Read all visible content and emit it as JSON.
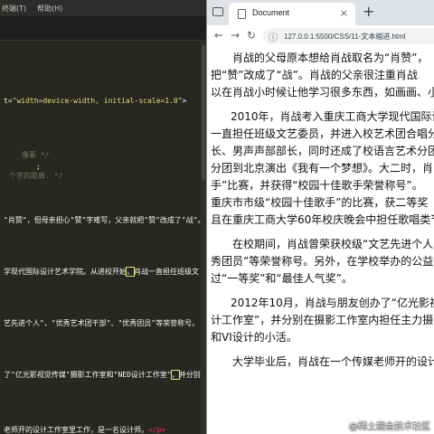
{
  "editor": {
    "menu": [
      "终端(T)",
      "帮助(H)"
    ],
    "code": [
      {
        "parts": [
          {
            "t": "t=",
            "c": "white"
          },
          {
            "t": "\"width=device-width, initial-scale=1.0\"",
            "c": "yellow"
          },
          {
            "t": ">",
            "c": "white"
          }
        ]
      },
      {
        "parts": [
          {
            "t": "像素 */",
            "c": "gray"
          }
        ]
      },
      {
        "parts": [
          {
            "t": ";",
            "c": "white"
          }
        ]
      },
      {
        "parts": [
          {
            "t": "个字的距离. */",
            "c": "gray"
          }
        ]
      },
      {
        "parts": [
          {
            "t": "\"肖赞\"，但母亲担心\"赞\"字难写，父亲就把\"赞\"改成了\"战\"。",
            "c": "white"
          }
        ]
      },
      {
        "parts": [
          {
            "t": "学现代国际设计艺术学院。从进校开始",
            "c": "white"
          },
          {
            "t": "，",
            "c": "hl"
          },
          {
            "t": "肖战一直担任班级文",
            "c": "white"
          }
        ]
      },
      {
        "parts": [
          {
            "t": "艺先进个人\"、\"优秀艺术团干部\"、\"优秀团员\"等荣誉称号。",
            "c": "white"
          }
        ]
      },
      {
        "parts": [
          {
            "t": "了\"亿光影视觉传媒\"摄影工作室和\"NED设计工作室\"",
            "c": "white"
          },
          {
            "t": "，",
            "c": "hl"
          },
          {
            "t": "并分别在",
            "c": "white"
          }
        ]
      },
      {
        "parts": [
          {
            "t": "老师开的设计工作室里工作，是一名设计师。",
            "c": "white"
          },
          {
            "t": "</p>",
            "c": "pink"
          }
        ]
      }
    ]
  },
  "browser": {
    "tab_title": "Document",
    "tab_close": "×",
    "new_tab": "+",
    "nav_back": "←",
    "nav_forward": "→",
    "nav_reload": "↻",
    "info_icon": "ⓘ",
    "url": "127.0.0.1:5500/CSS/11-文本缩进.html"
  },
  "content_lines": [
    "肖战的父母原本想给肖战取名为“肖赞”，",
    "把“赞”改成了“战”。肖战的父亲很注重肖战",
    "以在肖战小时候让他学习很多东西，如画画、小",
    "2010年，肖战考入重庆工商大学现代国际设",
    "一直担任班级文艺委员，并进入校艺术团合唱分",
    "长、男声声部部长，同时还成了校语言艺术分团",
    "分团到北京演出《我有一个梦想》。大二时，肖",
    "手”比赛，并获得“校园十佳歌手荣誉称号”。",
    "重庆市市级“校园十佳歌手”的比赛，获二等奖",
    "且在重庆工商大学60年校庆晚会中担任歌唱类节",
    "在校期间，肖战曾荣获校级“文艺先进个人",
    "秀团员”等荣誉称号。另外，在学校举办的公益",
    "过“一等奖”和“最佳人气奖”。",
    "2012年10月，肖战与朋友创办了“亿光影视",
    "计工作室”，并分别在摄影工作室内担任主力摄",
    "和VI设计的小活。",
    "大学毕业后，肖战在一个传媒老师开的设计"
  ],
  "watermark": "@稀土掘金技术社区"
}
